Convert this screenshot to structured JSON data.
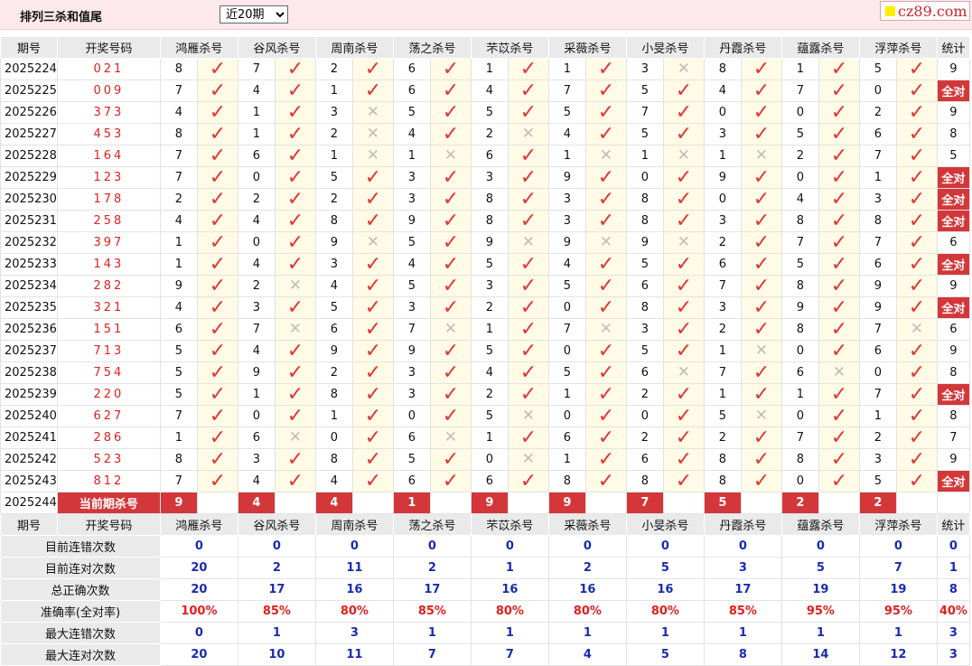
{
  "header": {
    "title": "排列三杀和值尾",
    "select_value": "近20期",
    "logo_text": "cz89.com"
  },
  "columns": [
    "期号",
    "开奖号码",
    "鸿雁杀号",
    "谷风杀号",
    "周南杀号",
    "荡之杀号",
    "芣苡杀号",
    "采薇杀号",
    "小旻杀号",
    "丹霞杀号",
    "蕴露杀号",
    "浮萍杀号",
    "统计"
  ],
  "rows": [
    {
      "issue": "2025224",
      "draw": "021",
      "kills": [
        "8",
        "7",
        "2",
        "6",
        "1",
        "1",
        "3",
        "8",
        "1",
        "5"
      ],
      "res": "yyyyyyxyyy",
      "stat": "9"
    },
    {
      "issue": "2025225",
      "draw": "009",
      "kills": [
        "7",
        "4",
        "1",
        "6",
        "4",
        "7",
        "5",
        "4",
        "7",
        "0"
      ],
      "res": "yyyyyyyyyy",
      "stat": "全对"
    },
    {
      "issue": "2025226",
      "draw": "373",
      "kills": [
        "4",
        "1",
        "3",
        "5",
        "5",
        "5",
        "7",
        "0",
        "0",
        "2"
      ],
      "res": "yyxyyyyyyy",
      "stat": "9"
    },
    {
      "issue": "2025227",
      "draw": "453",
      "kills": [
        "8",
        "1",
        "2",
        "4",
        "2",
        "4",
        "5",
        "3",
        "5",
        "6"
      ],
      "res": "yyxyxyyyyy",
      "stat": "8"
    },
    {
      "issue": "2025228",
      "draw": "164",
      "kills": [
        "7",
        "6",
        "1",
        "1",
        "6",
        "1",
        "1",
        "1",
        "2",
        "7"
      ],
      "res": "yyxxyxxxyy",
      "stat": "5"
    },
    {
      "issue": "2025229",
      "draw": "123",
      "kills": [
        "7",
        "0",
        "5",
        "3",
        "3",
        "9",
        "0",
        "9",
        "0",
        "1"
      ],
      "res": "yyyyyyyyyy",
      "stat": "全对"
    },
    {
      "issue": "2025230",
      "draw": "178",
      "kills": [
        "2",
        "2",
        "2",
        "3",
        "8",
        "3",
        "8",
        "0",
        "4",
        "3"
      ],
      "res": "yyyyyyyyyy",
      "stat": "全对"
    },
    {
      "issue": "2025231",
      "draw": "258",
      "kills": [
        "4",
        "4",
        "8",
        "9",
        "8",
        "3",
        "8",
        "3",
        "8",
        "8"
      ],
      "res": "yyyyyyyyyy",
      "stat": "全对"
    },
    {
      "issue": "2025232",
      "draw": "397",
      "kills": [
        "1",
        "0",
        "9",
        "5",
        "9",
        "9",
        "9",
        "2",
        "7",
        "7"
      ],
      "res": "yyxyxxxyyy",
      "stat": "6"
    },
    {
      "issue": "2025233",
      "draw": "143",
      "kills": [
        "1",
        "4",
        "3",
        "4",
        "5",
        "4",
        "5",
        "6",
        "5",
        "6"
      ],
      "res": "yyyyyyyyyy",
      "stat": "全对"
    },
    {
      "issue": "2025234",
      "draw": "282",
      "kills": [
        "9",
        "2",
        "4",
        "5",
        "3",
        "5",
        "6",
        "7",
        "8",
        "9"
      ],
      "res": "yxyyyyyyyy",
      "stat": "9"
    },
    {
      "issue": "2025235",
      "draw": "321",
      "kills": [
        "4",
        "3",
        "5",
        "3",
        "2",
        "0",
        "8",
        "3",
        "9",
        "9"
      ],
      "res": "yyyyyyyyyy",
      "stat": "全对"
    },
    {
      "issue": "2025236",
      "draw": "151",
      "kills": [
        "6",
        "7",
        "6",
        "7",
        "1",
        "7",
        "3",
        "2",
        "8",
        "7"
      ],
      "res": "yxyxyxyyyx",
      "stat": "6"
    },
    {
      "issue": "2025237",
      "draw": "713",
      "kills": [
        "5",
        "4",
        "9",
        "9",
        "5",
        "0",
        "5",
        "1",
        "0",
        "6"
      ],
      "res": "yyyyyyyxyy",
      "stat": "9"
    },
    {
      "issue": "2025238",
      "draw": "754",
      "kills": [
        "5",
        "9",
        "2",
        "3",
        "4",
        "5",
        "6",
        "7",
        "6",
        "0"
      ],
      "res": "yyyyyyxyxy",
      "stat": "8"
    },
    {
      "issue": "2025239",
      "draw": "220",
      "kills": [
        "5",
        "1",
        "8",
        "3",
        "2",
        "1",
        "2",
        "1",
        "1",
        "7"
      ],
      "res": "yyyyyyyyyy",
      "stat": "全对"
    },
    {
      "issue": "2025240",
      "draw": "627",
      "kills": [
        "7",
        "0",
        "1",
        "0",
        "5",
        "0",
        "0",
        "5",
        "0",
        "1"
      ],
      "res": "yyyyxyyxyy",
      "stat": "8"
    },
    {
      "issue": "2025241",
      "draw": "286",
      "kills": [
        "1",
        "6",
        "0",
        "6",
        "1",
        "6",
        "2",
        "2",
        "7",
        "2"
      ],
      "res": "yxyxyyyyyy",
      "stat": "7"
    },
    {
      "issue": "2025242",
      "draw": "523",
      "kills": [
        "8",
        "3",
        "8",
        "5",
        "0",
        "1",
        "6",
        "8",
        "8",
        "3"
      ],
      "res": "yyyyxyyyyy",
      "stat": "9"
    },
    {
      "issue": "2025243",
      "draw": "812",
      "kills": [
        "7",
        "4",
        "4",
        "6",
        "6",
        "8",
        "8",
        "8",
        "0",
        "5"
      ],
      "res": "yyyyyyyyyy",
      "stat": "全对"
    }
  ],
  "current": {
    "issue": "2025244",
    "label": "当前期杀号",
    "kills": [
      "9",
      "4",
      "4",
      "1",
      "9",
      "9",
      "7",
      "5",
      "2",
      "2"
    ]
  },
  "stats": [
    {
      "label": "目前连错次数",
      "values": [
        "0",
        "0",
        "0",
        "0",
        "0",
        "0",
        "0",
        "0",
        "0",
        "0",
        "0"
      ]
    },
    {
      "label": "目前连对次数",
      "values": [
        "20",
        "2",
        "11",
        "2",
        "1",
        "2",
        "5",
        "3",
        "5",
        "7",
        "1"
      ]
    },
    {
      "label": "总正确次数",
      "values": [
        "20",
        "17",
        "16",
        "17",
        "16",
        "16",
        "16",
        "17",
        "19",
        "19",
        "8"
      ]
    },
    {
      "label": "准确率(全对率)",
      "values": [
        "100%",
        "85%",
        "80%",
        "85%",
        "80%",
        "80%",
        "80%",
        "85%",
        "95%",
        "95%",
        "40%"
      ]
    },
    {
      "label": "最大连错次数",
      "values": [
        "0",
        "1",
        "3",
        "1",
        "1",
        "1",
        "1",
        "1",
        "1",
        "1",
        "3"
      ]
    },
    {
      "label": "最大连对次数",
      "values": [
        "20",
        "10",
        "11",
        "7",
        "7",
        "4",
        "5",
        "8",
        "14",
        "12",
        "3"
      ]
    }
  ],
  "marks": {
    "correct": "✓",
    "wrong": "✕"
  },
  "colors": {
    "accent_red": "#d4373a",
    "number_red": "#e0201f",
    "stat_blue": "#1a2bb0",
    "header_bg": "#fde9ec",
    "mark_bg": "#fffbe6"
  }
}
